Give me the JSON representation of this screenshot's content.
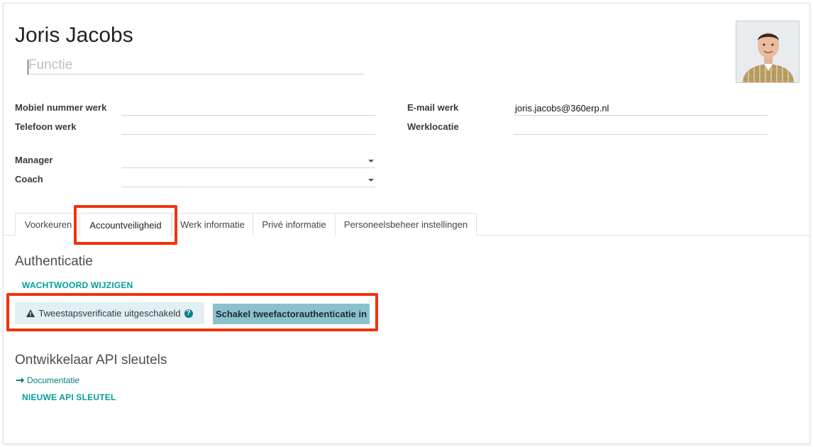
{
  "employee": {
    "name": "Joris Jacobs",
    "job_title_placeholder": "Functie"
  },
  "fields": {
    "mobile_work_label": "Mobiel nummer werk",
    "mobile_work_value": "",
    "phone_work_label": "Telefoon werk",
    "phone_work_value": "",
    "email_work_label": "E-mail werk",
    "email_work_value": "joris.jacobs@360erp.nl",
    "work_location_label": "Werklocatie",
    "work_location_value": "",
    "manager_label": "Manager",
    "manager_value": "",
    "coach_label": "Coach",
    "coach_value": ""
  },
  "tabs": [
    {
      "label": "Voorkeuren"
    },
    {
      "label": "Accountveiligheid"
    },
    {
      "label": "Werk informatie"
    },
    {
      "label": "Privé informatie"
    },
    {
      "label": "Personeelsbeheer instellingen"
    }
  ],
  "authentication": {
    "title": "Authenticatie",
    "change_password": "WACHTWOORD WIJZIGEN",
    "two_step_status": "Tweestapsverificatie uitgeschakeld",
    "enable_2fa_button": "Schakel tweefactorauthenticatie in"
  },
  "api_keys": {
    "title": "Ontwikkelaar API sleutels",
    "documentation": "Documentatie",
    "new_key": "NIEUWE API SLEUTEL"
  },
  "icons": {
    "warning": "warning-icon",
    "help": "help-icon",
    "arrow": "arrow-right-icon",
    "dropdown": "chevron-down-icon"
  },
  "colors": {
    "accent": "#00a09d",
    "highlight": "#f0330f",
    "alert_bg": "#e2eff3",
    "button_bg": "#8bc1cf"
  }
}
